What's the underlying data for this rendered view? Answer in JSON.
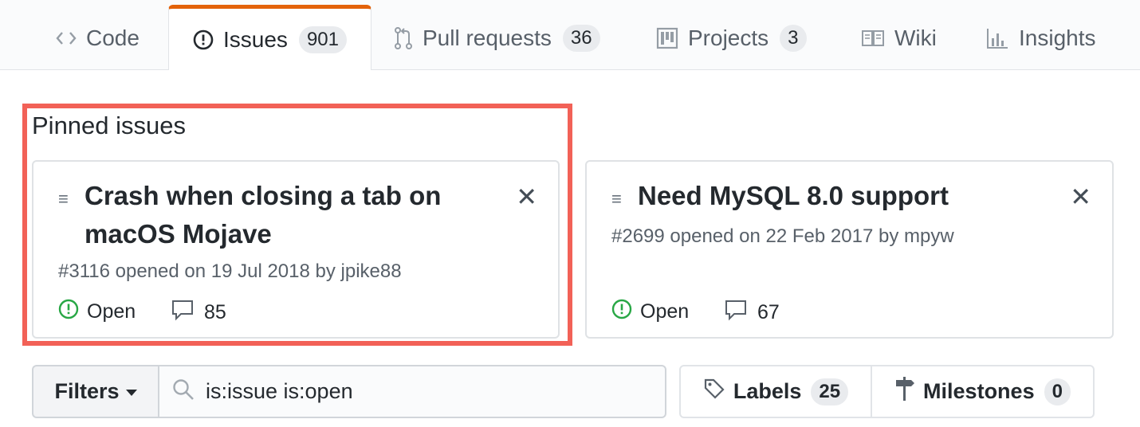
{
  "tabs": [
    {
      "label": "Code",
      "icon": "code-icon",
      "count": ""
    },
    {
      "label": "Issues",
      "icon": "issue-opened-icon",
      "count": "901"
    },
    {
      "label": "Pull requests",
      "icon": "git-pull-request-icon",
      "count": "36"
    },
    {
      "label": "Projects",
      "icon": "project-icon",
      "count": "3"
    },
    {
      "label": "Wiki",
      "icon": "book-icon",
      "count": ""
    },
    {
      "label": "Insights",
      "icon": "graph-icon",
      "count": ""
    }
  ],
  "selected_tab": "Issues",
  "pinned": {
    "title": "Pinned issues",
    "issues": [
      {
        "title_line1": "Crash when closing a tab on",
        "title_line2": "macOS Mojave",
        "meta": "#3116 opened on 19 Jul 2018 by jpike88",
        "status": "Open",
        "comments": "85",
        "close_glyph": "✕"
      },
      {
        "title_line1": "Need MySQL 8.0 support",
        "title_line2": "",
        "meta": "#2699 opened on 22 Feb 2017 by mpyw",
        "status": "Open",
        "comments": "67",
        "close_glyph": "✕"
      }
    ]
  },
  "filters": {
    "label": "Filters",
    "search_value": "is:issue is:open"
  },
  "labels_button": {
    "label": "Labels",
    "count": "25"
  },
  "milestones_button": {
    "label": "Milestones",
    "count": "0"
  },
  "colors": {
    "accent": "#e36209",
    "highlight": "#f26157",
    "open_green": "#28a745"
  }
}
